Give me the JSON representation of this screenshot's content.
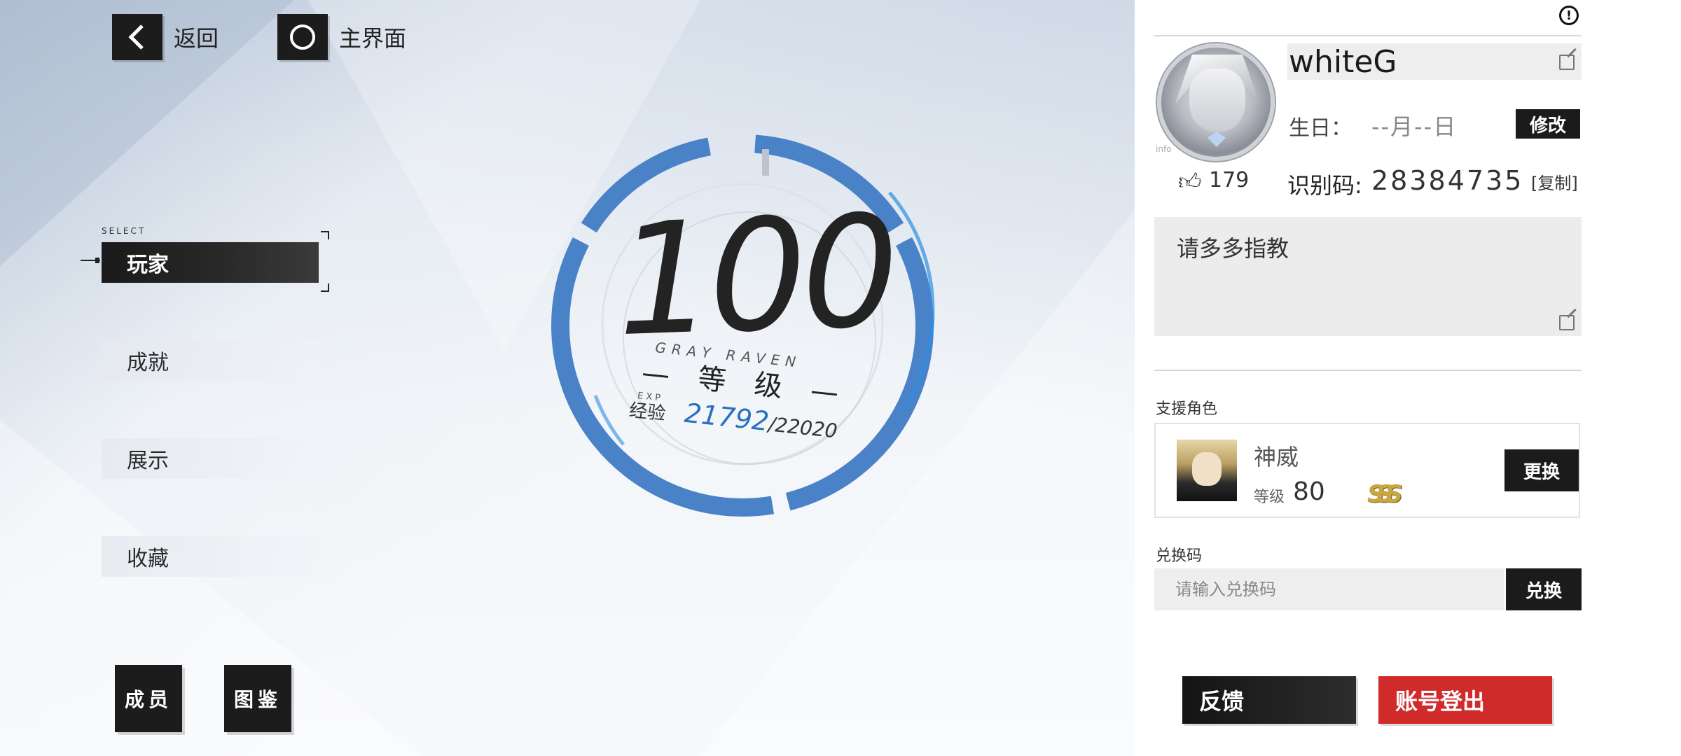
{
  "nav": {
    "back_label": "返回",
    "home_label": "主界面"
  },
  "menu": {
    "select_tag": "SELECT",
    "items": [
      {
        "label": "玩家",
        "active": true
      },
      {
        "label": "成就",
        "active": false
      },
      {
        "label": "展示",
        "active": false
      },
      {
        "label": "收藏",
        "active": false
      }
    ]
  },
  "bottom_left": {
    "members_label": "成员",
    "codex_label": "图鉴"
  },
  "level": {
    "value": "100",
    "brand": "GRAY  RAVEN",
    "label": "— 等 级 —",
    "exp_tag": "EXP",
    "exp_key": "经验",
    "exp_current": "21792",
    "exp_max": "/22020",
    "exp_fraction": 0.9897,
    "ring_color": "#4a82c8"
  },
  "profile": {
    "info_tag": "info",
    "name": "whiteG",
    "birthday_label": "生日：",
    "birthday_value": "--月--日",
    "modify_label": "修改",
    "likes": "179",
    "id_label": "识别码:",
    "id_value": "28384735",
    "copy_label": "[复制]",
    "signature": "请多多指教"
  },
  "support": {
    "section_label": "支援角色",
    "char_name": "神威",
    "level_key": "等级",
    "level_value": "80",
    "rank": "SSS",
    "change_label": "更换"
  },
  "redeem": {
    "section_label": "兑换码",
    "placeholder": "请输入兑换码",
    "button_label": "兑换"
  },
  "actions": {
    "feedback_label": "反馈",
    "logout_label": "账号登出",
    "logout_color": "#d02a2a"
  },
  "icons": {
    "back": "chevron-left-icon",
    "home": "ring-icon",
    "warn": "exclamation-circle-icon",
    "edit": "edit-icon",
    "like": "thumbs-up-icon"
  }
}
